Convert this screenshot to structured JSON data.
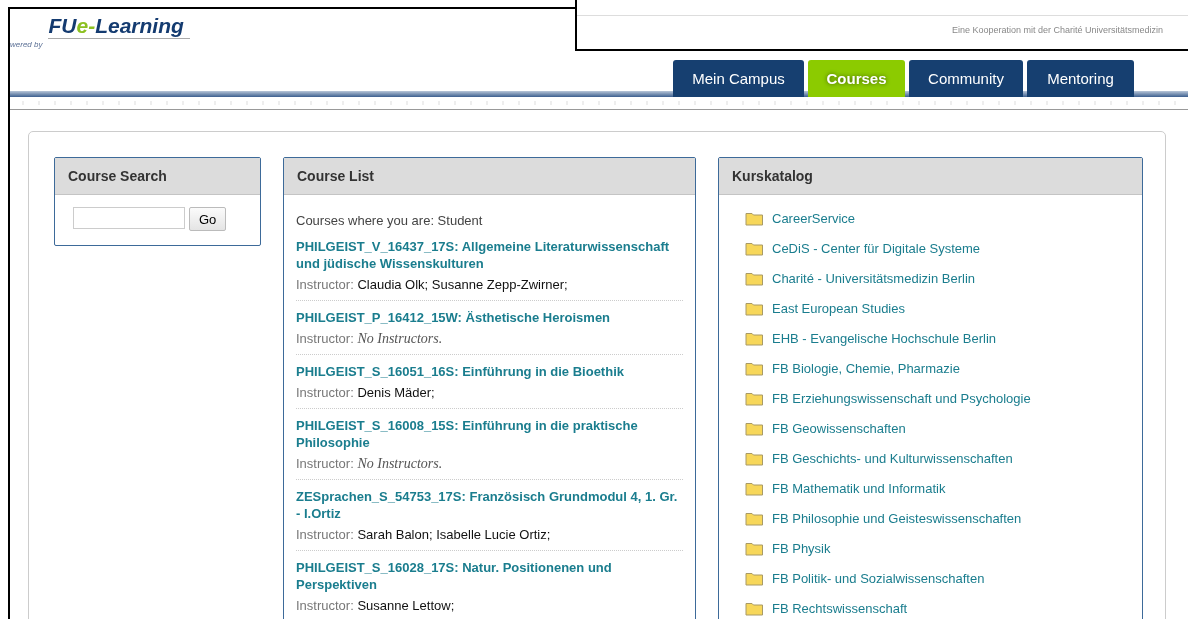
{
  "logo": {
    "powered_by": "wered by",
    "prefix": "FU",
    "accent": "e-",
    "suffix": "Learning"
  },
  "overlay_window": {
    "text": "Eine Kooperation mit der Charité Universitätsmedizin"
  },
  "tabs": [
    {
      "label": "Mein Campus",
      "selected": false
    },
    {
      "label": "Courses",
      "selected": true
    },
    {
      "label": "Community",
      "selected": false
    },
    {
      "label": "Mentoring",
      "selected": false
    }
  ],
  "course_search": {
    "title": "Course Search",
    "button": "Go"
  },
  "course_list": {
    "title": "Course List",
    "role_line": "Courses where you are: Student",
    "courses": [
      {
        "title": "PHILGEIST_V_16437_17S: Allgemeine Literaturwissenschaft und jüdische Wissenskulturen",
        "label": "Instructor:",
        "kind": "names",
        "instructors": "Claudia Olk;  Susanne Zepp-Zwirner;"
      },
      {
        "title": "PHILGEIST_P_16412_15W: Ästhetische Heroismen",
        "label": "Instructor:",
        "kind": "none",
        "instructors": "No Instructors."
      },
      {
        "title": "PHILGEIST_S_16051_16S: Einführung in die Bioethik",
        "label": "Instructor:",
        "kind": "names",
        "instructors": "Denis Mäder;"
      },
      {
        "title": "PHILGEIST_S_16008_15S: Einführung in die praktische Philosophie",
        "label": "Instructor:",
        "kind": "none",
        "instructors": "No Instructors."
      },
      {
        "title": "ZESprachen_S_54753_17S: Französisch Grundmodul 4, 1. Gr. - I.Ortiz",
        "label": "Instructor:",
        "kind": "names",
        "instructors": "Sarah Balon;  Isabelle Lucie Ortiz;"
      },
      {
        "title": "PHILGEIST_S_16028_17S: Natur. Positionenen und Perspektiven",
        "label": "Instructor:",
        "kind": "names",
        "instructors": "Susanne Lettow;"
      }
    ]
  },
  "kurskatalog": {
    "title": "Kurskatalog",
    "items": [
      "CareerService",
      "CeDiS - Center für Digitale Systeme",
      "Charité - Universitätsmedizin Berlin",
      "East European Studies",
      "EHB - Evangelische Hochschule Berlin",
      "FB Biologie, Chemie, Pharmazie",
      "FB Erziehungswissenschaft und Psychologie",
      "FB Geowissenschaften",
      "FB Geschichts- und Kulturwissenschaften",
      "FB Mathematik und Informatik",
      "FB Philosophie und Geisteswissenschaften",
      "FB Physik",
      "FB Politik- und Sozialwissenschaften",
      "FB Rechtswissenschaft"
    ]
  }
}
